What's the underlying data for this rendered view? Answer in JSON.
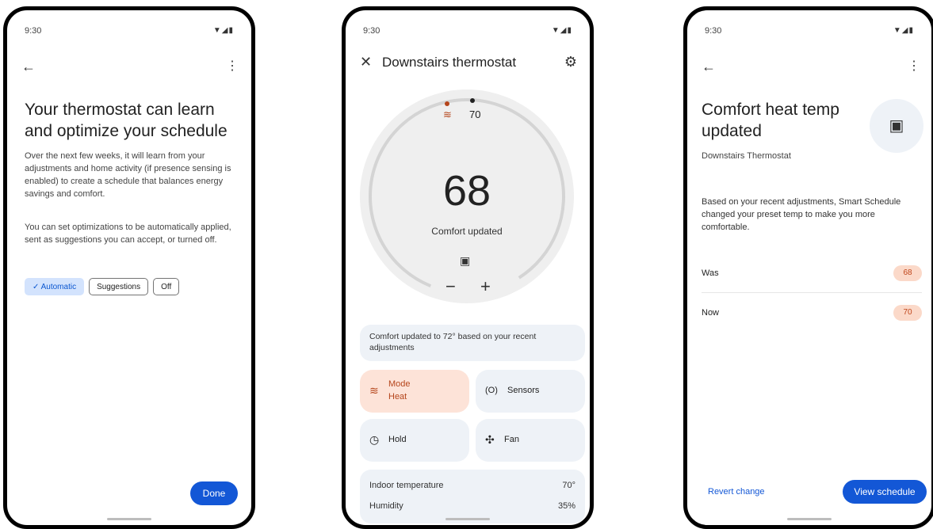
{
  "screen1": {
    "time": "9:30",
    "heading": "Your thermostat can learn and optimize your schedule",
    "para1": "Over the next few weeks, it will learn from your adjustments and home activity (if presence sensing is enabled) to create a schedule that balances energy savings and comfort.",
    "para2": "You can set optimizations to be automatically applied, sent as suggestions you can accept, or turned off.",
    "options": [
      "Automatic",
      "Suggestions",
      "Off"
    ],
    "selected": "Automatic",
    "done_label": "Done"
  },
  "screen2": {
    "time": "9:30",
    "title": "Downstairs thermostat",
    "setpoint": "70",
    "current_temp": "68",
    "status": "Comfort updated",
    "banner": "Comfort updated to 72° based on your recent adjustments",
    "tiles": {
      "mode_label": "Mode",
      "mode_value": "Heat",
      "sensors": "Sensors",
      "hold": "Hold",
      "fan": "Fan"
    },
    "indoor_label": "Indoor temperature",
    "indoor_value": "70°",
    "humidity_label": "Humidity",
    "humidity_value": "35%",
    "accent": "#b5451b"
  },
  "screen3": {
    "time": "9:30",
    "heading": "Comfort heat temp updated",
    "subtitle": "Downstairs Thermostat",
    "body": "Based on your recent adjustments, Smart Schedule changed your preset temp to make you more comfortable.",
    "was_label": "Was",
    "was_value": "68",
    "now_label": "Now",
    "now_value": "70",
    "revert_label": "Revert change",
    "view_label": "View schedule"
  }
}
